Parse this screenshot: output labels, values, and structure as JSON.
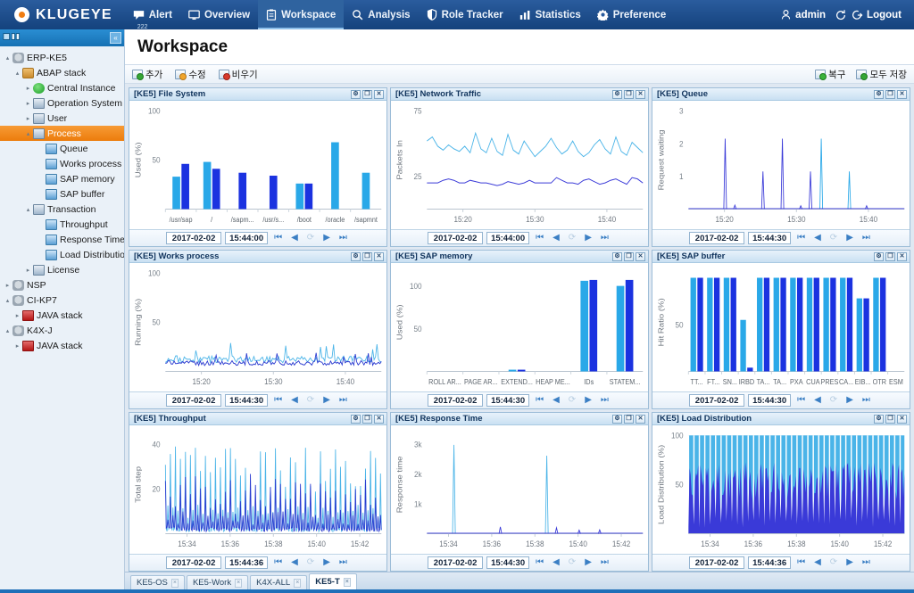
{
  "app": {
    "brand": "KLUGEYE",
    "nav": [
      {
        "label": "Alert",
        "icon": "alert-icon",
        "badge": "222",
        "active": false
      },
      {
        "label": "Overview",
        "icon": "monitor-icon",
        "badge": "",
        "active": false
      },
      {
        "label": "Workspace",
        "icon": "clipboard-icon",
        "badge": "",
        "active": true
      },
      {
        "label": "Analysis",
        "icon": "search-icon",
        "badge": "",
        "active": false
      },
      {
        "label": "Role Tracker",
        "icon": "shield-icon",
        "badge": "",
        "active": false
      },
      {
        "label": "Statistics",
        "icon": "bar-chart-icon",
        "badge": "",
        "active": false
      },
      {
        "label": "Preference",
        "icon": "gear-icon",
        "badge": "",
        "active": false
      }
    ],
    "user": "admin",
    "logout": "Logout"
  },
  "sidebar": {
    "collapse_label": "«",
    "tree": [
      {
        "label": "ERP-KE5",
        "level": 1,
        "icon": "server-icon",
        "twisty": "▴",
        "selected": false
      },
      {
        "label": "ABAP stack",
        "level": 2,
        "icon": "stack-icon",
        "twisty": "▴",
        "selected": false
      },
      {
        "label": "Central Instance",
        "level": 3,
        "icon": "globe-icon",
        "twisty": "▸",
        "selected": false
      },
      {
        "label": "Operation System",
        "level": 3,
        "icon": "monitor-icon",
        "twisty": "▸",
        "selected": false
      },
      {
        "label": "User",
        "level": 3,
        "icon": "monitor-icon",
        "twisty": "▸",
        "selected": false
      },
      {
        "label": "Process",
        "level": 3,
        "icon": "monitor-icon",
        "twisty": "▴",
        "selected": true
      },
      {
        "label": "Queue",
        "level": 4,
        "icon": "monitor-small-icon",
        "twisty": "",
        "selected": false
      },
      {
        "label": "Works process",
        "level": 4,
        "icon": "monitor-small-icon",
        "twisty": "",
        "selected": false
      },
      {
        "label": "SAP memory",
        "level": 4,
        "icon": "monitor-small-icon",
        "twisty": "",
        "selected": false
      },
      {
        "label": "SAP buffer",
        "level": 4,
        "icon": "monitor-small-icon",
        "twisty": "",
        "selected": false
      },
      {
        "label": "Transaction",
        "level": 3,
        "icon": "monitor-icon",
        "twisty": "▴",
        "selected": false
      },
      {
        "label": "Throughput",
        "level": 4,
        "icon": "monitor-small-icon",
        "twisty": "",
        "selected": false
      },
      {
        "label": "Response Time",
        "level": 4,
        "icon": "monitor-small-icon",
        "twisty": "",
        "selected": false
      },
      {
        "label": "Load Distribution",
        "level": 4,
        "icon": "monitor-small-icon",
        "twisty": "",
        "selected": false
      },
      {
        "label": "License",
        "level": 3,
        "icon": "monitor-icon",
        "twisty": "▸",
        "selected": false
      },
      {
        "label": "NSP",
        "level": 1,
        "icon": "server-icon",
        "twisty": "▸",
        "selected": false
      },
      {
        "label": "CI-KP7",
        "level": 1,
        "icon": "server-icon",
        "twisty": "▴",
        "selected": false
      },
      {
        "label": "JAVA stack",
        "level": 2,
        "icon": "java-icon",
        "twisty": "▸",
        "selected": false
      },
      {
        "label": "K4X-J",
        "level": 1,
        "icon": "server-icon",
        "twisty": "▴",
        "selected": false
      },
      {
        "label": "JAVA stack",
        "level": 2,
        "icon": "java-icon",
        "twisty": "▸",
        "selected": false
      }
    ]
  },
  "page": {
    "title": "Workspace",
    "toolbar_left": [
      {
        "label": "추가",
        "icon": "add-icon"
      },
      {
        "label": "수정",
        "icon": "edit-icon"
      },
      {
        "label": "비우기",
        "icon": "clear-icon"
      }
    ],
    "toolbar_right": [
      {
        "label": "복구",
        "icon": "restore-icon"
      },
      {
        "label": "모두 저장",
        "icon": "save-all-icon"
      }
    ]
  },
  "panel_controls": {
    "settings": "⚙",
    "maximize": "❐",
    "close": "✕"
  },
  "nav_controls": {
    "first": "⏮",
    "prev": "◀",
    "refresh": "⟳",
    "next": "▶",
    "last": "⏭"
  },
  "tabs": [
    {
      "label": "KE5-OS",
      "active": false,
      "close": "×"
    },
    {
      "label": "KE5-Work",
      "active": false,
      "close": "×"
    },
    {
      "label": "K4X-ALL",
      "active": false,
      "close": "×"
    },
    {
      "label": "KE5-T",
      "active": true,
      "close": "×"
    }
  ],
  "colors": {
    "series_light": "#29a8e8",
    "series_dark": "#1b32e0",
    "accent_orange": "#f08a1e",
    "nav_blue": "#1d4e8f",
    "axis_gray": "#8a9099"
  },
  "chart_data": [
    {
      "id": "file-system",
      "panel_title": "[KE5] File System",
      "type": "bar",
      "ylabel": "Used (%)",
      "ylim": [
        0,
        100
      ],
      "yticks": [
        50,
        100
      ],
      "categories": [
        "/usr/sap",
        "/",
        "/sapm...",
        "/usr/s...",
        "/boot",
        "/oracle",
        "/sapmnt"
      ],
      "series": [
        {
          "name": "used-a",
          "color": "#29a8e8",
          "values": [
            33,
            48,
            null,
            null,
            26,
            68,
            37
          ]
        },
        {
          "name": "used-b",
          "color": "#1b32e0",
          "values": [
            46,
            41,
            37,
            34,
            26,
            null,
            null
          ]
        }
      ],
      "date": "2017-02-02",
      "time": "15:44:00"
    },
    {
      "id": "network-traffic",
      "panel_title": "[KE5] Network Traffic",
      "type": "line",
      "ylabel": "Packets In",
      "ylim": [
        0,
        75
      ],
      "yticks": [
        25,
        75
      ],
      "xticks": [
        "15:20",
        "15:30",
        "15:40"
      ],
      "series": [
        {
          "name": "packets-in",
          "color": "#4ab4e8",
          "values": [
            52,
            55,
            48,
            45,
            49,
            46,
            44,
            48,
            43,
            58,
            46,
            43,
            54,
            44,
            41,
            57,
            45,
            42,
            52,
            46,
            40,
            44,
            48,
            54,
            47,
            42,
            45,
            52,
            44,
            40,
            43,
            49,
            53,
            46,
            42,
            55,
            44,
            41,
            51,
            47,
            43
          ]
        },
        {
          "name": "packets-out",
          "color": "#3a3ad8",
          "values": [
            20,
            20,
            20,
            22,
            23,
            22,
            20,
            20,
            22,
            21,
            20,
            20,
            19,
            18,
            19,
            21,
            20,
            19,
            20,
            22,
            20,
            20,
            20,
            20,
            24,
            22,
            20,
            20,
            19,
            22,
            23,
            21,
            19,
            20,
            22,
            23,
            21,
            19,
            24,
            23,
            20
          ]
        }
      ],
      "date": "2017-02-02",
      "time": "15:44:00"
    },
    {
      "id": "queue",
      "panel_title": "[KE5] Queue",
      "type": "line",
      "ylabel": "Request waiting",
      "ylim": [
        0,
        3
      ],
      "yticks": [
        1,
        2,
        3
      ],
      "xticks": [
        "15:20",
        "15:30",
        "15:40"
      ],
      "spikes": [
        {
          "x": 0.17,
          "y": 2.15,
          "color": "#3a3ad8"
        },
        {
          "x": 0.215,
          "y": 0.12,
          "color": "#3a3ad8"
        },
        {
          "x": 0.345,
          "y": 1.15,
          "color": "#3a3ad8"
        },
        {
          "x": 0.435,
          "y": 2.15,
          "color": "#3a3ad8"
        },
        {
          "x": 0.52,
          "y": 0.1,
          "color": "#3a3ad8"
        },
        {
          "x": 0.565,
          "y": 1.15,
          "color": "#3a3ad8"
        },
        {
          "x": 0.615,
          "y": 2.15,
          "color": "#29a8e8"
        },
        {
          "x": 0.745,
          "y": 1.15,
          "color": "#29a8e8"
        },
        {
          "x": 0.825,
          "y": 0.1,
          "color": "#3a3ad8"
        }
      ],
      "date": "2017-02-02",
      "time": "15:44:30"
    },
    {
      "id": "works-process",
      "panel_title": "[KE5] Works process",
      "type": "line",
      "ylabel": "Running (%)",
      "ylim": [
        0,
        100
      ],
      "yticks": [
        50,
        100
      ],
      "xticks": [
        "15:20",
        "15:30",
        "15:40"
      ],
      "series": [
        {
          "name": "running-a",
          "color": "#4ab4e8",
          "noise_base": 9,
          "noise_amp": 7,
          "spike_max": 20
        },
        {
          "name": "running-b",
          "color": "#2a3ad0",
          "noise_base": 6,
          "noise_amp": 5,
          "spike_max": 13
        }
      ],
      "date": "2017-02-02",
      "time": "15:44:30"
    },
    {
      "id": "sap-memory",
      "panel_title": "[KE5] SAP memory",
      "type": "bar",
      "ylabel": "Used (%)",
      "ylim": [
        0,
        115
      ],
      "yticks": [
        50,
        100
      ],
      "categories": [
        "ROLL AR...",
        "PAGE AR...",
        "EXTEND...",
        "HEAP ME...",
        "IDs",
        "STATEM..."
      ],
      "series": [
        {
          "name": "used-a",
          "color": "#29a8e8",
          "values": [
            0,
            0,
            2,
            0,
            106,
            100
          ]
        },
        {
          "name": "used-b",
          "color": "#1b32e0",
          "values": [
            0,
            0,
            2,
            0,
            107,
            107
          ]
        }
      ],
      "date": "2017-02-02",
      "time": "15:44:30"
    },
    {
      "id": "sap-buffer",
      "panel_title": "[KE5] SAP buffer",
      "type": "bar",
      "ylabel": "Hit Ratio (%)",
      "ylim": [
        0,
        105
      ],
      "yticks": [
        50
      ],
      "categories": [
        "TT...",
        "FT...",
        "SN...",
        "IRBD",
        "TA...",
        "TA...",
        "PXA",
        "CUA",
        "PRES",
        "CA...",
        "EIB...",
        "OTR",
        "ESM"
      ],
      "series": [
        {
          "name": "hit-a",
          "color": "#29a8e8",
          "values": [
            100,
            100,
            100,
            55,
            100,
            100,
            100,
            100,
            100,
            100,
            78,
            100,
            0
          ]
        },
        {
          "name": "hit-b",
          "color": "#1b32e0",
          "values": [
            100,
            100,
            100,
            4,
            100,
            100,
            100,
            100,
            100,
            100,
            78,
            100,
            0
          ]
        }
      ],
      "date": "2017-02-02",
      "time": "15:44:30"
    },
    {
      "id": "throughput",
      "panel_title": "[KE5] Throughput",
      "type": "line",
      "ylabel": "Total step",
      "ylim": [
        0,
        44
      ],
      "yticks": [
        20,
        40
      ],
      "xticks": [
        "15:34",
        "15:36",
        "15:38",
        "15:40",
        "15:42"
      ],
      "series": [
        {
          "name": "total-step-a",
          "color": "#4ab4e8",
          "peak_max": 40,
          "peak_min": 14
        },
        {
          "name": "total-step-b",
          "color": "#2a3ad0",
          "peak_max": 27,
          "peak_min": 8
        }
      ],
      "date": "2017-02-02",
      "time": "15:44:36"
    },
    {
      "id": "response-time",
      "panel_title": "[KE5] Response Time",
      "type": "line",
      "ylabel": "Response time",
      "ylim": [
        0,
        3300
      ],
      "yticks": [
        "1k",
        "2k",
        "3k"
      ],
      "xticks": [
        "15:34",
        "15:36",
        "15:38",
        "15:40",
        "15:42"
      ],
      "spikes": [
        {
          "x": 0.125,
          "y": 2980,
          "color": "#4ab4e8"
        },
        {
          "x": 0.34,
          "y": 230,
          "color": "#3a3ad8"
        },
        {
          "x": 0.555,
          "y": 2620,
          "color": "#4ab4e8"
        },
        {
          "x": 0.6,
          "y": 200,
          "color": "#3a3ad8"
        },
        {
          "x": 0.705,
          "y": 120,
          "color": "#3a3ad8"
        },
        {
          "x": 0.8,
          "y": 130,
          "color": "#3a3ad8"
        }
      ],
      "date": "2017-02-02",
      "time": "15:44:30"
    },
    {
      "id": "load-distribution",
      "panel_title": "[KE5] Load Distribution",
      "type": "area",
      "ylabel": "Load Distribution (%)",
      "ylim": [
        0,
        100
      ],
      "yticks": [
        50,
        100
      ],
      "xticks": [
        "15:34",
        "15:36",
        "15:38",
        "15:40",
        "15:42"
      ],
      "series": [
        {
          "name": "upper-band",
          "color": "#4ab4e8"
        },
        {
          "name": "lower-band",
          "color": "#3a3ad8"
        }
      ],
      "date": "2017-02-02",
      "time": "15:44:36"
    }
  ]
}
